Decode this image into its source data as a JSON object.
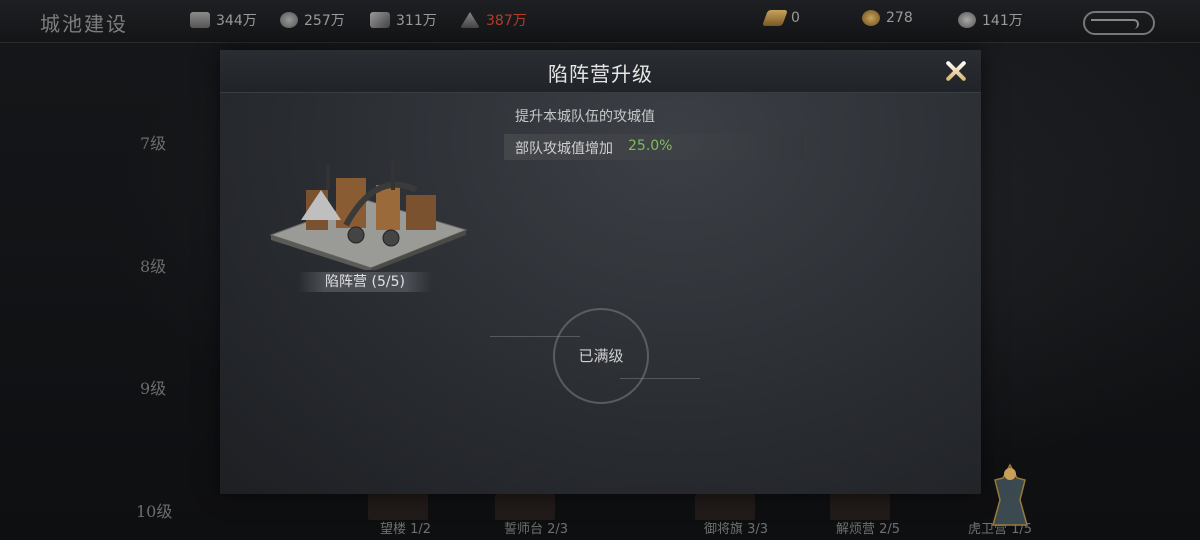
{
  "top": {
    "title": "城池建设",
    "resources": [
      {
        "icon": "wood-icon",
        "value": "344万"
      },
      {
        "icon": "stone-icon",
        "value": "257万"
      },
      {
        "icon": "iron-icon",
        "value": "311万"
      },
      {
        "icon": "grain-icon",
        "value": "387万",
        "color": "#b63c2a"
      }
    ],
    "currencies": [
      {
        "icon": "gold-bar-icon",
        "value": "0"
      },
      {
        "icon": "jade-icon",
        "value": "278"
      },
      {
        "icon": "coin-icon",
        "value": "141万"
      }
    ]
  },
  "levels": [
    "7级",
    "8级",
    "9级",
    "10级"
  ],
  "bottom_buildings": [
    {
      "label": "望楼 1/2"
    },
    {
      "label": "誓师台 2/3"
    },
    {
      "label": "御将旗 3/3"
    },
    {
      "label": "解烦营 2/5"
    },
    {
      "label": "虎卫营 1/5"
    }
  ],
  "dialog": {
    "title": "陷阵营升级",
    "description": "提升本城队伍的攻城值",
    "stat_label": "部队攻城值增加",
    "stat_value": "25.0%",
    "building_name": "陷阵营 (5/5)",
    "status": "已满级"
  },
  "colors": {
    "accent_green": "#7fbd5a",
    "warn_red": "#b63c2a"
  }
}
